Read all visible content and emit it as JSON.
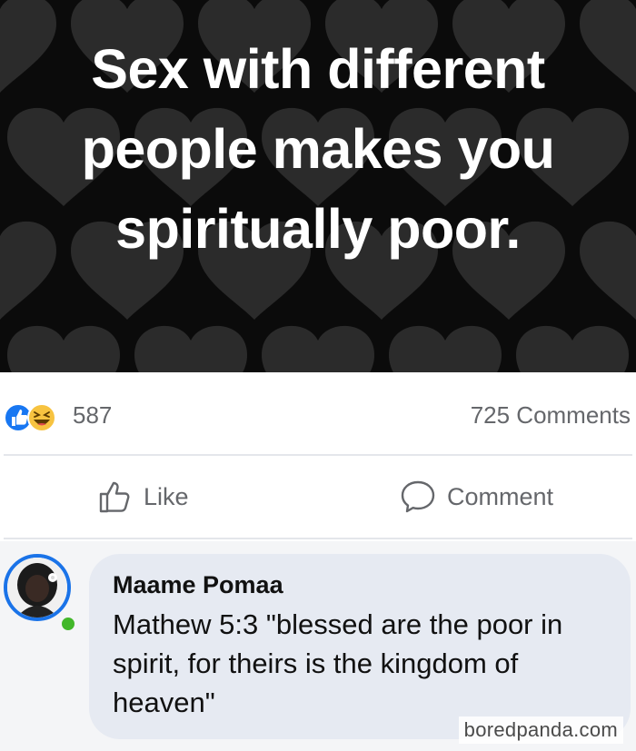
{
  "post": {
    "caption_lines": [
      "Sex with different",
      "people makes you",
      "spiritually poor."
    ]
  },
  "reactions": {
    "count": "587",
    "comments": "725 Comments",
    "icons": [
      "thumbs-up-icon",
      "laughing-face-icon"
    ]
  },
  "actions": {
    "like_label": "Like",
    "comment_label": "Comment"
  },
  "comment": {
    "author": "Maame Pomaa",
    "text": "Mathew 5:3 \"blessed are the poor in spirit, for theirs is the kingdom of heaven\""
  },
  "watermark": "boredpanda.com",
  "colors": {
    "like_blue": "#1877f2",
    "haha_yellow": "#f7c340",
    "online_green": "#42b72a",
    "avatar_ring": "#1a73e8"
  }
}
